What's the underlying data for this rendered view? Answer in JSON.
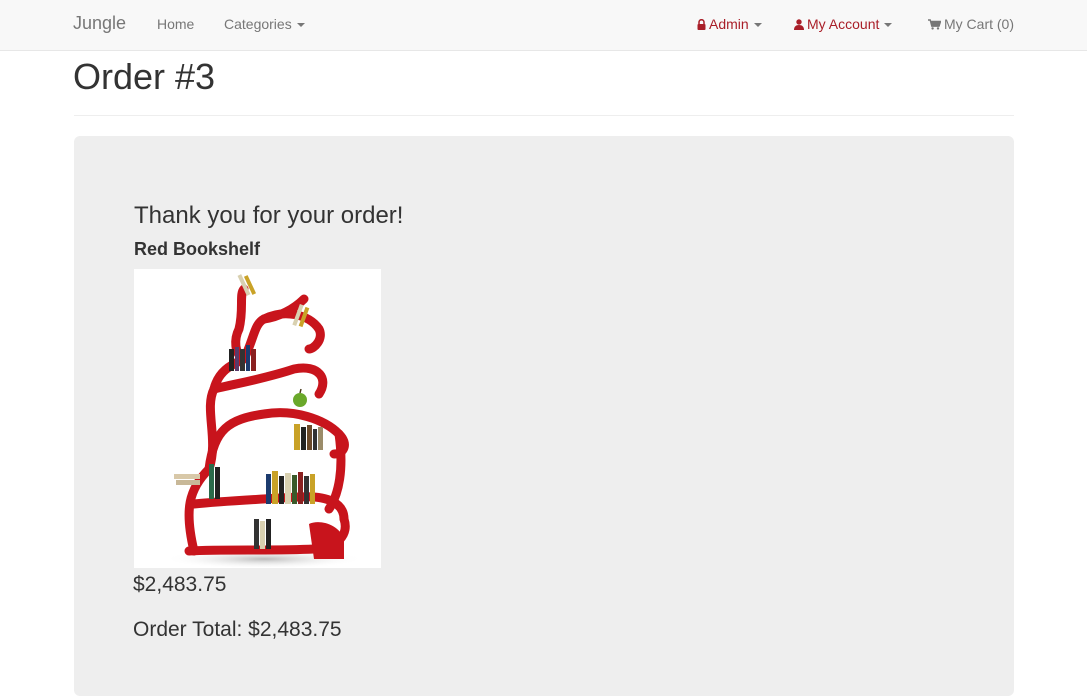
{
  "navbar": {
    "brand": "Jungle",
    "home": "Home",
    "categories": "Categories",
    "admin": "Admin",
    "my_account": "My Account",
    "cart": "My Cart (0)"
  },
  "page": {
    "title": "Order #3"
  },
  "order": {
    "thank_you": "Thank you for your order!",
    "item_name": "Red Bookshelf",
    "item_price": "$2,483.75",
    "total_label": "Order Total: $2,483.75"
  },
  "colors": {
    "accent_red": "#a91e28",
    "navbar_bg": "#f8f8f8",
    "panel_bg": "#eeeeee",
    "shelf_red": "#c8141c"
  },
  "icons": [
    "lock-icon",
    "user-icon",
    "cart-icon",
    "caret-down-icon"
  ]
}
